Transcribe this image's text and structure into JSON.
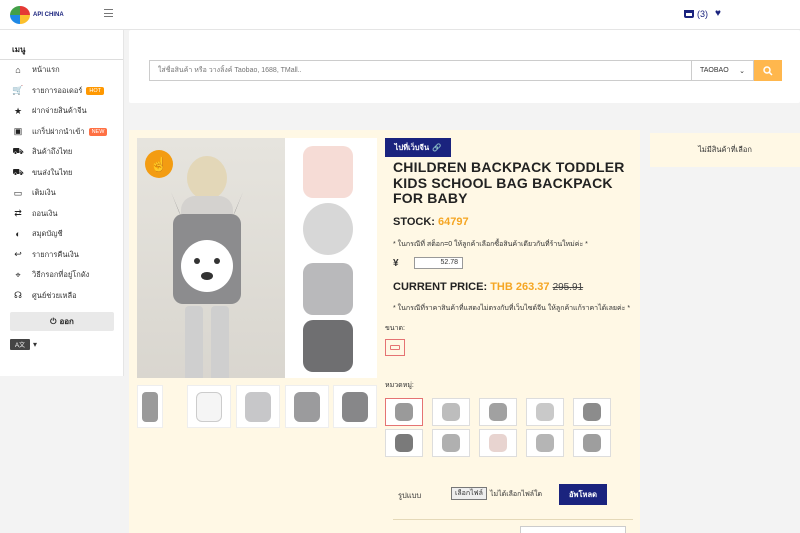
{
  "header": {
    "logo_text": "API CHINA",
    "cart_count": "(3)"
  },
  "sidebar": {
    "title": "เมนู",
    "items": [
      {
        "label": "หน้าแรก",
        "icon": "home-icon"
      },
      {
        "label": "รายการออเดอร์",
        "icon": "cart-icon",
        "badge": "HOT"
      },
      {
        "label": "ฝากจ่ายสินค้าจีน",
        "icon": "star-icon"
      },
      {
        "label": "แกร็ปฝากนำเข้า",
        "icon": "box-icon",
        "badge": "NEW"
      },
      {
        "label": "สินค้าถึงไทย",
        "icon": "truck-icon"
      },
      {
        "label": "ขนส่งในไทย",
        "icon": "delivery-icon"
      },
      {
        "label": "เติมเงิน",
        "icon": "money-icon"
      },
      {
        "label": "ถอนเงิน",
        "icon": "exchange-icon"
      },
      {
        "label": "สมุดบัญชี",
        "icon": "piggy-bank-icon"
      },
      {
        "label": "รายการคืนเงิน",
        "icon": "refund-icon"
      },
      {
        "label": "วิธีกรอกที่อยู่โกดัง",
        "icon": "map-icon"
      },
      {
        "label": "ศูนย์ช่วยเหลือ",
        "icon": "headset-icon"
      }
    ],
    "logout_label": "ออก",
    "lang_label": "A文"
  },
  "search": {
    "placeholder": "ใส่ชื่อสินค้า หรือ วางลิ้งค์ Taobao, 1688, TMall..",
    "platform": "TAOBAO"
  },
  "product": {
    "link_button": "ไปที่เว็บจีน",
    "title": "CHILDREN BACKPACK TODDLER KIDS SCHOOL BAG BACKPACK FOR BABY",
    "stock_label": "STOCK:",
    "stock_value": "64797",
    "stock_note": "* ในกรณีที่ สต็อก=0 ให้ลูกค้าเลือกซื้อสินค้าเดียวกันที่ร้านใหม่ค่ะ *",
    "currency_symbol": "¥",
    "yuan_price": "52.78",
    "price_label": "CURRENT PRICE:",
    "price_value": "THB 263.37",
    "price_old": "295.91",
    "price_note": "* ในกรณีที่ราคาสินค้าที่แสดงไม่ตรงกับที่เว็บไซด์จีน ให้ลูกค้าแก้ราคาได้เลยค่ะ *",
    "size_label": "ขนาด:",
    "category_label": "หมวดหมู่:",
    "upload_label": "รูปแบบ",
    "file_button": "เลือกไฟล์",
    "file_status": "ไม่ได้เลือกไฟล์ใด",
    "upload_button": "อัพโหลด"
  },
  "side_panel": {
    "empty_text": "ไม่มีสินค้าที่เลือก"
  },
  "colors": {
    "navy": "#1a237e",
    "orange": "#f5a623",
    "cream": "#fff8e5"
  }
}
